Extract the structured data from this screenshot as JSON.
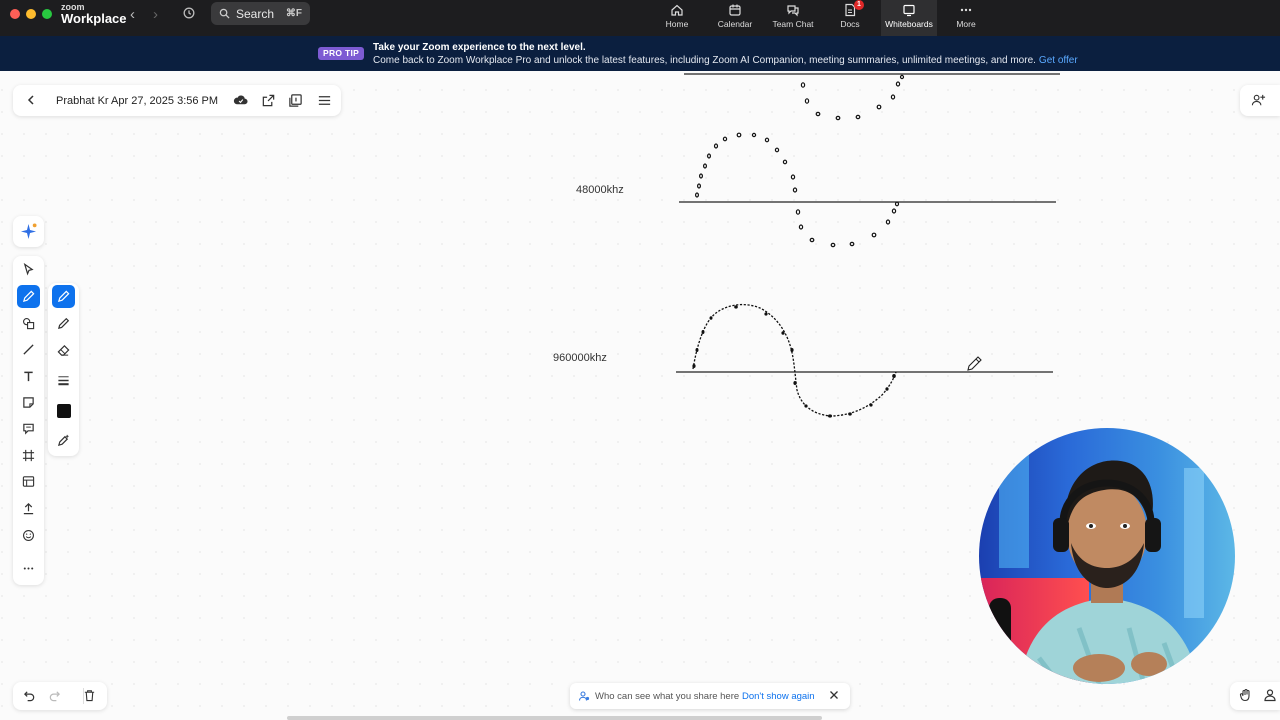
{
  "app": {
    "brand_small": "zoom",
    "brand_name": "Workplace",
    "search_label": "Search",
    "search_shortcut": "⌘F"
  },
  "nav": {
    "tabs": [
      {
        "label": "Home",
        "icon": "home-icon"
      },
      {
        "label": "Calendar",
        "icon": "calendar-icon"
      },
      {
        "label": "Team Chat",
        "icon": "chat-icon"
      },
      {
        "label": "Docs",
        "icon": "docs-icon",
        "badge": "1"
      },
      {
        "label": "Whiteboards",
        "icon": "whiteboard-icon",
        "active": true
      },
      {
        "label": "More",
        "icon": "more-icon"
      }
    ]
  },
  "banner": {
    "tag": "PRO TIP",
    "title": "Take your Zoom experience to the next level.",
    "body": "Come back to Zoom Workplace Pro and unlock the latest features, including Zoom AI Companion, meeting summaries, unlimited meetings, and more.",
    "link": "Get offer"
  },
  "document": {
    "title": "Prabhat Kr Apr 27, 2025 3:56 PM"
  },
  "canvas": {
    "labels": [
      "48000khz",
      "960000khz"
    ]
  },
  "share_notice": {
    "text": "Who can see what you share here",
    "link": "Don't show again"
  },
  "colors": {
    "accent": "#0e72ed",
    "titlebar": "#1d1d1f",
    "banner": "#0b1f3f",
    "protip": "#7d5bd3"
  }
}
